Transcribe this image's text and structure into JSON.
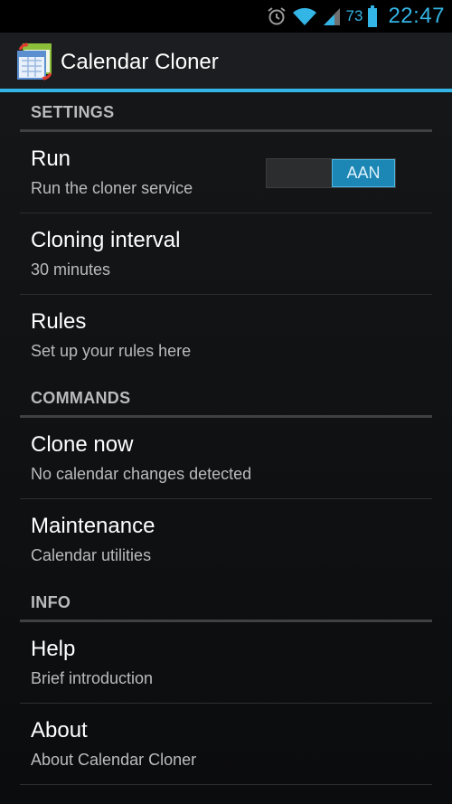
{
  "status_bar": {
    "battery_percent": "73",
    "time": "22:47",
    "icons": [
      "alarm-icon",
      "wifi-icon",
      "signal-icon",
      "battery-icon"
    ],
    "accent_color": "#33b5e5"
  },
  "action_bar": {
    "title": "Calendar Cloner",
    "icon": "calendar-cloner-app-icon"
  },
  "sections": {
    "settings": {
      "header": "SETTINGS",
      "run": {
        "title": "Run",
        "summary": "Run the cloner service",
        "toggle_label": "AAN",
        "toggle_on": true
      },
      "cloning_interval": {
        "title": "Cloning interval",
        "summary": "30 minutes"
      },
      "rules": {
        "title": "Rules",
        "summary": "Set up your rules here"
      }
    },
    "commands": {
      "header": "COMMANDS",
      "clone_now": {
        "title": "Clone now",
        "summary": "No calendar changes detected"
      },
      "maintenance": {
        "title": "Maintenance",
        "summary": "Calendar utilities"
      }
    },
    "info": {
      "header": "INFO",
      "help": {
        "title": "Help",
        "summary": "Brief introduction"
      },
      "about": {
        "title": "About",
        "summary": "About Calendar Cloner"
      }
    }
  }
}
